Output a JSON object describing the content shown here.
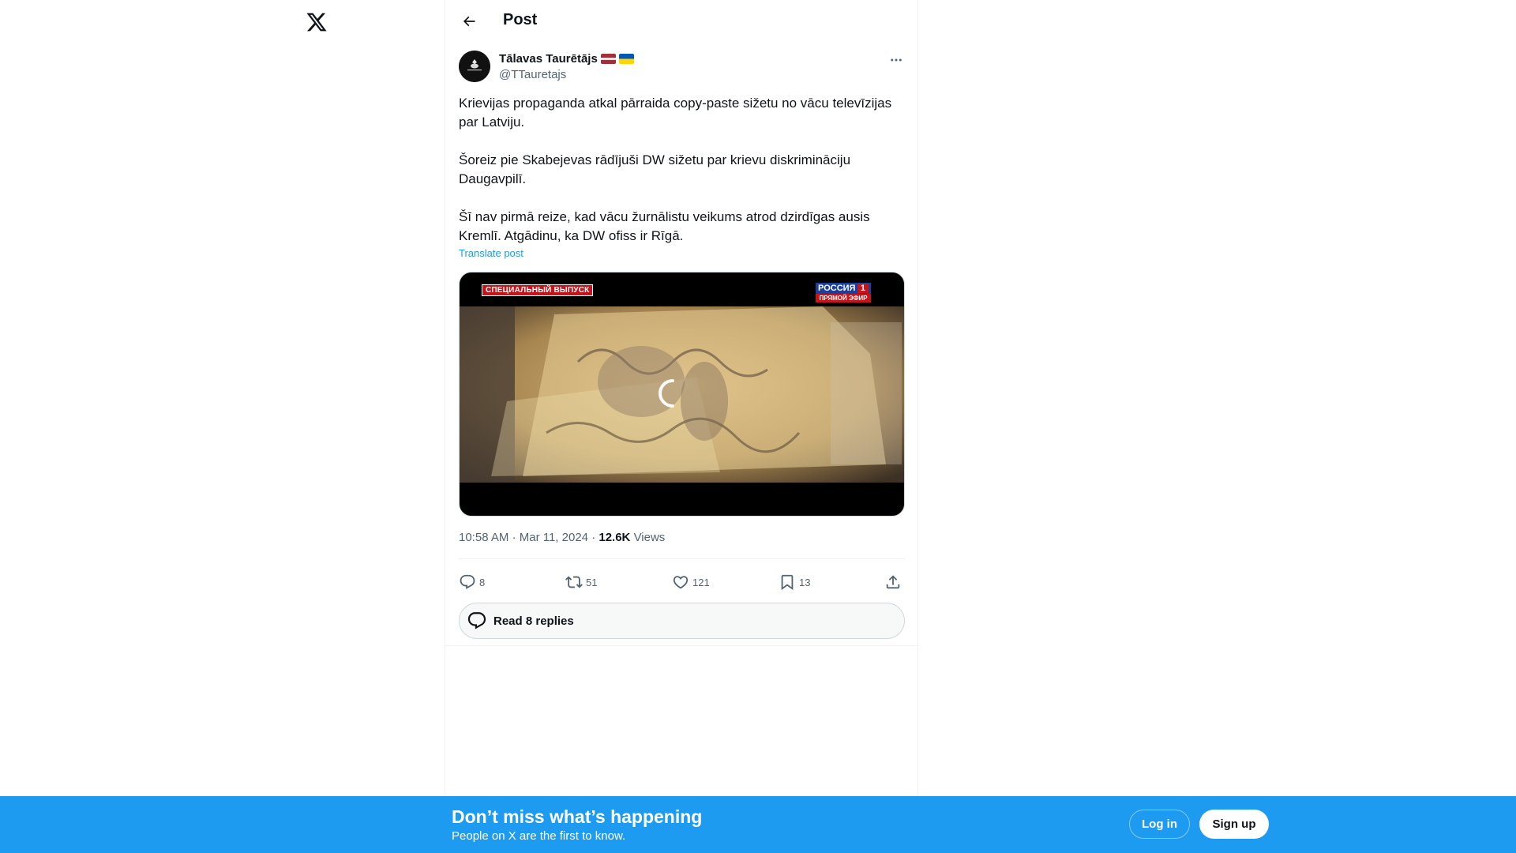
{
  "nav": {
    "logo_icon": "x-logo-icon"
  },
  "header": {
    "back_icon": "arrow-left-icon",
    "title": "Post"
  },
  "post": {
    "author": {
      "name": "Tālavas Taurētājs",
      "flags": [
        "latvia-flag",
        "ukraine-flag"
      ],
      "handle": "@TTauretajs"
    },
    "more_icon": "more-horizontal-icon",
    "paragraphs": [
      "Krievijas propaganda atkal pārraida copy-paste sižetu no vācu televīzijas par Latviju.",
      "Šoreiz pie Skabejevas rādījuši DW sižetu par krievu diskrimināciju Daugavpilī.",
      "Šī nav pirmā reize, kad vācu žurnālistu veikums atrod dzirdīgas ausis Kremlī. Atgādinu, ka DW ofiss ir Rīgā."
    ],
    "translate_label": "Translate post",
    "video": {
      "overlay_special": "СПЕЦИАЛЬНЫЙ ВЫПУСК",
      "channel_name": "РОССИЯ",
      "channel_number": "1",
      "channel_live": "ПРЯМОЙ ЭФИР",
      "state": "loading"
    },
    "time": "10:58 AM",
    "date": "Mar 11, 2024",
    "views_count": "12.6K",
    "views_label": "Views",
    "actions": {
      "replies": "8",
      "reposts": "51",
      "likes": "121",
      "bookmarks": "13"
    },
    "read_replies_label": "Read 8 replies"
  },
  "bottom_bar": {
    "title": "Don’t miss what’s happening",
    "subtitle": "People on X are the first to know.",
    "login_label": "Log in",
    "signup_label": "Sign up"
  },
  "colors": {
    "accent": "#1d9bf0",
    "text": "#0f1419",
    "secondary": "#536471"
  }
}
